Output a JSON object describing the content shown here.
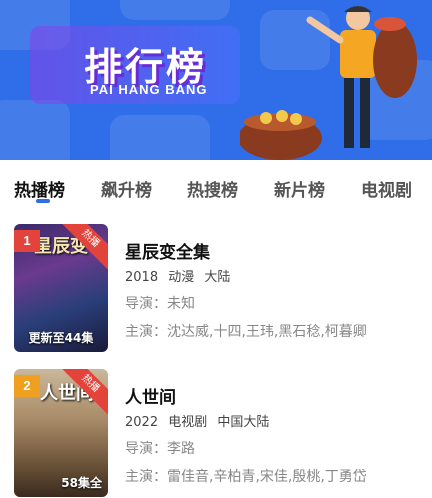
{
  "banner": {
    "title": "排行榜",
    "subtitle": "PAI HANG BANG"
  },
  "tabs": [
    {
      "label": "热播榜",
      "active": true
    },
    {
      "label": "飙升榜",
      "active": false
    },
    {
      "label": "热搜榜",
      "active": false
    },
    {
      "label": "新片榜",
      "active": false
    },
    {
      "label": "电视剧",
      "active": false
    }
  ],
  "items": [
    {
      "rank": "1",
      "hot_badge": "热播",
      "poster_title": "星辰变",
      "poster_update": "更新至44集",
      "name": "星辰变全集",
      "year": "2018",
      "genre": "动漫",
      "region": "大陆",
      "director_label": "导演：",
      "director": "未知",
      "actors_label": "主演：",
      "actors": "沈达威,十四,王玮,黑石稔,柯暮卿"
    },
    {
      "rank": "2",
      "hot_badge": "热播",
      "poster_title": "人世间",
      "poster_update": "58集全",
      "name": "人世间",
      "year": "2022",
      "genre": "电视剧",
      "region": "中国大陆",
      "director_label": "导演：",
      "director": "李路",
      "actors_label": "主演：",
      "actors": "雷佳音,辛柏青,宋佳,殷桃,丁勇岱"
    }
  ],
  "colors": {
    "accent": "#2f6ee8",
    "hot_badge": "#e2433a",
    "rank1": "#e2433a",
    "rank2": "#f0a020"
  }
}
